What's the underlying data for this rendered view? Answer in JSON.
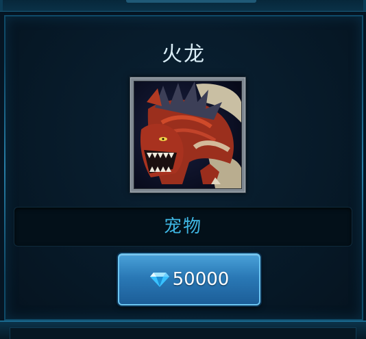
{
  "card": {
    "title": "火龙",
    "portrait": {
      "subject": "fire-dragon-portrait"
    },
    "category": "宠物",
    "price": {
      "icon": "diamond-icon",
      "amount": "50000"
    }
  },
  "colors": {
    "background": "#051523",
    "card_border": "#0f4a68",
    "category_text": "#3fb7e4",
    "button_blue": "#2a79b6",
    "title_text": "#d9edf6"
  }
}
